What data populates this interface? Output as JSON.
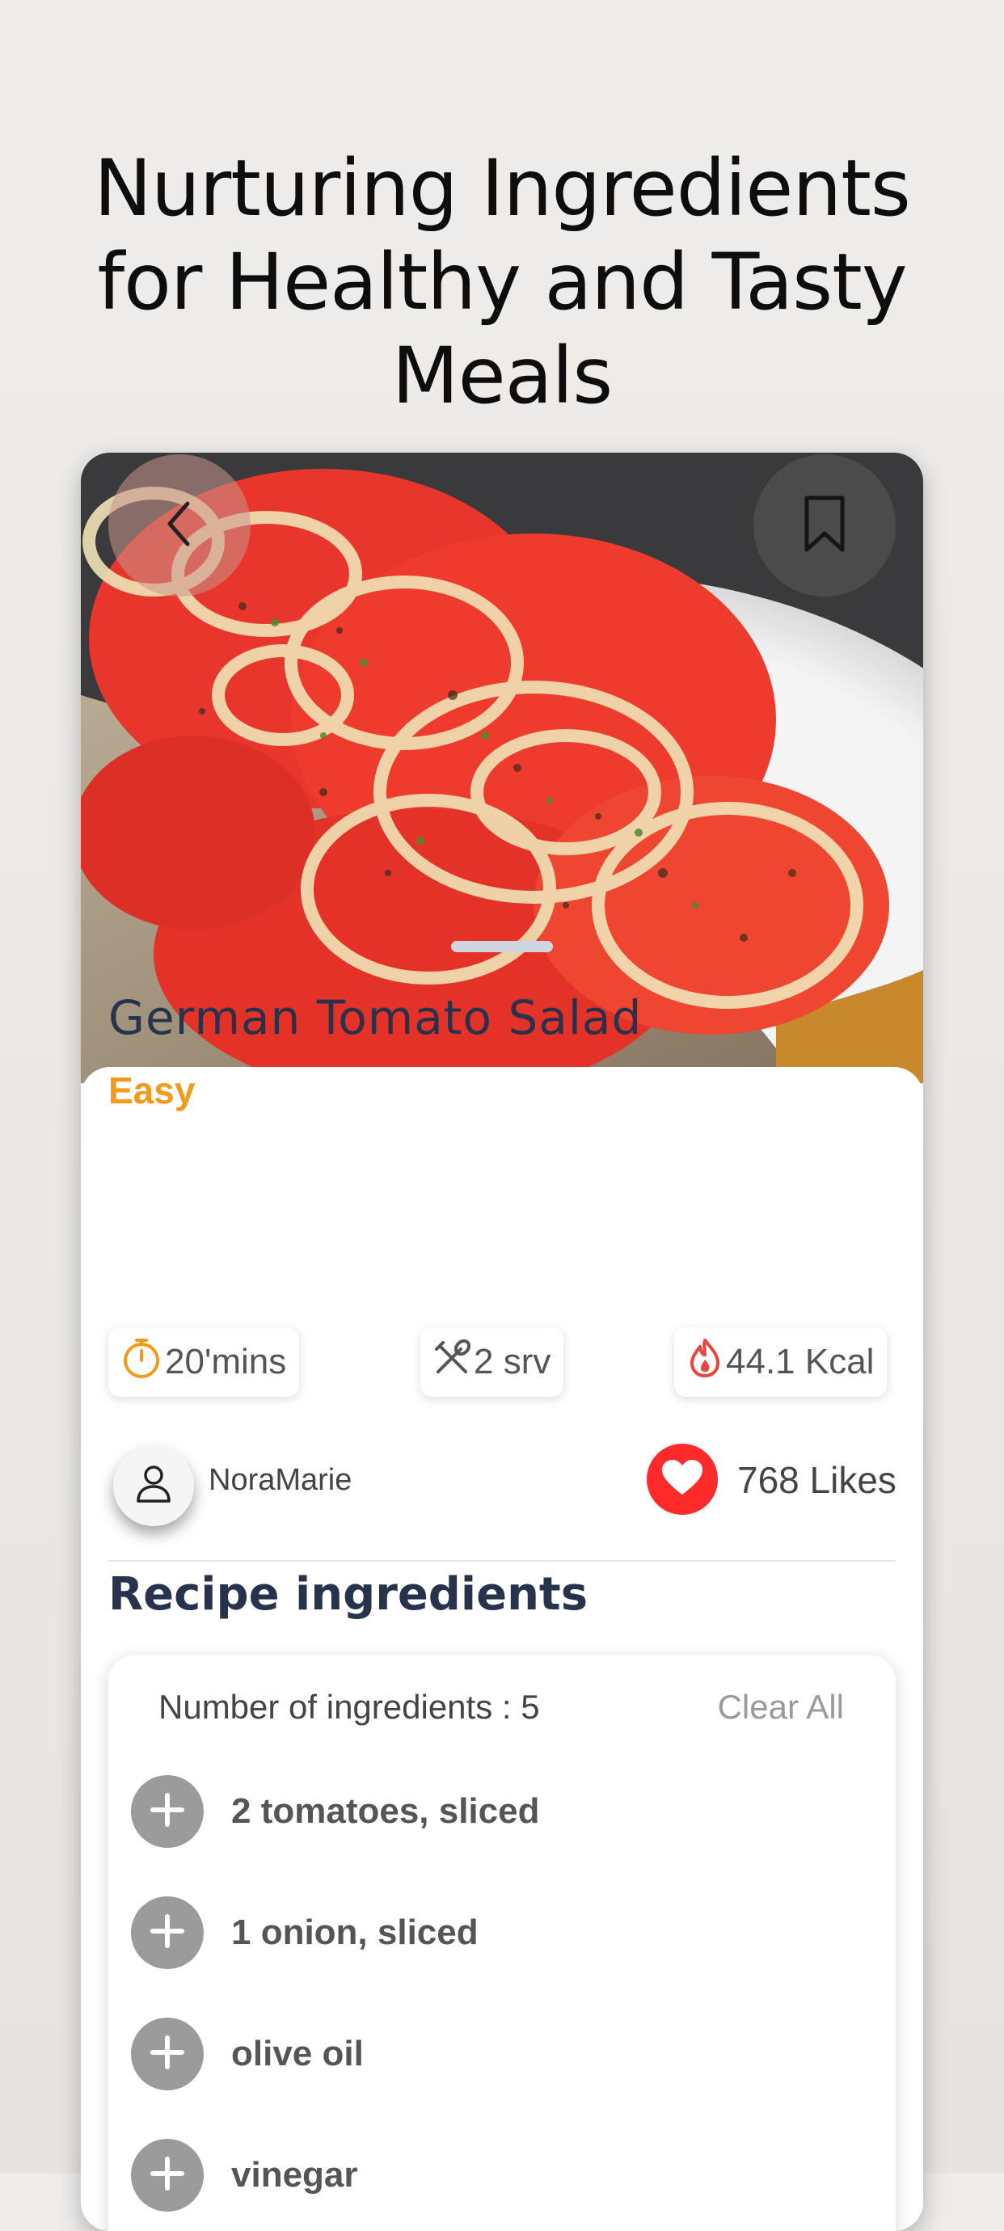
{
  "headline": "Nurturing Ingredients for Healthy and Tasty Meals",
  "recipe": {
    "title": "German Tomato Salad",
    "difficulty": "Easy",
    "time": "20'mins",
    "servings": "2 srv",
    "calories": "44.1 Kcal",
    "author": "NoraMarie",
    "likes": "768 Likes"
  },
  "ingredients_section": {
    "title": "Recipe ingredients",
    "count_label": "Number of ingredients : 5",
    "clear_label": "Clear All",
    "items": [
      "2 tomatoes, sliced",
      "1 onion, sliced",
      "olive oil",
      "vinegar"
    ]
  },
  "icons": {
    "back": "chevron-left-icon",
    "bookmark": "bookmark-icon",
    "time": "stopwatch-icon",
    "servings": "utensils-icon",
    "calories": "flame-icon",
    "author": "user-icon",
    "like": "heart-icon",
    "add": "plus-icon"
  },
  "colors": {
    "title": "#27334d",
    "difficulty": "#f39a1c",
    "like": "#ff2b2b",
    "add_button": "#9b9b9b"
  }
}
